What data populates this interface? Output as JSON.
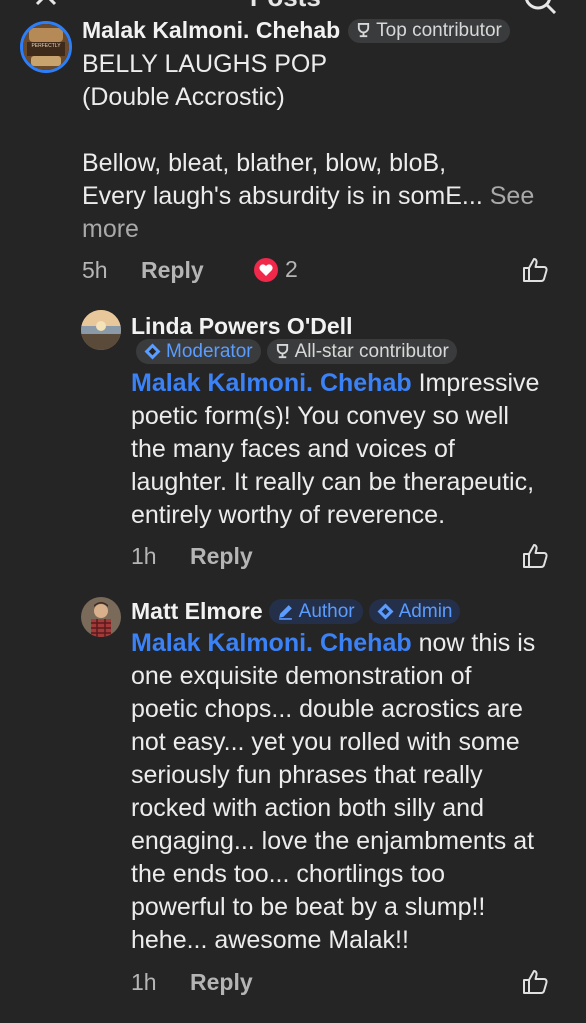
{
  "header": {
    "title": "Posts"
  },
  "comment1": {
    "author": "Malak Kalmoni. Chehab",
    "badge": "Top contributor",
    "title": "BELLY LAUGHS POP",
    "subtitle": "(Double Accrostic)",
    "line1": "Bellow, bleat, blather, blow, bloB,",
    "line2": "Every laugh's absurdity is in somE...",
    "see_more": "See",
    "see_more2": "more",
    "time": "5h",
    "reply_label": "Reply",
    "reaction_count": "2",
    "reaction_icon": "heart-icon",
    "avatar_text": "PERFECTLY"
  },
  "reply1": {
    "author": "Linda Powers O'Dell",
    "badges": [
      "Moderator",
      "All-star contributor"
    ],
    "mention": "Malak Kalmoni. Chehab",
    "lines": [
      "Impressive",
      "poetic form(s)! You convey so well",
      "the many faces and voices of",
      "laughter. It really can be therapeutic,",
      "entirely worthy of reverence."
    ],
    "time": "1h",
    "reply_label": "Reply"
  },
  "reply2": {
    "author": "Matt Elmore",
    "badges": [
      "Author",
      "Admin"
    ],
    "mention": "Malak Kalmoni. Chehab",
    "lines": [
      "now this is",
      "one exquisite demonstration of",
      "poetic chops... double acrostics are",
      "not easy... yet you rolled with some",
      "seriously fun phrases that really",
      "rocked with action both silly and",
      "engaging... love the enjambments at",
      "the ends too... chortlings too",
      "powerful to be beat by a slump!!",
      "hehe... awesome Malak!!"
    ],
    "time": "1h",
    "reply_label": "Reply"
  },
  "colors": {
    "background": "#252526",
    "mention": "#3b82f6",
    "heart": "#f0284a"
  }
}
